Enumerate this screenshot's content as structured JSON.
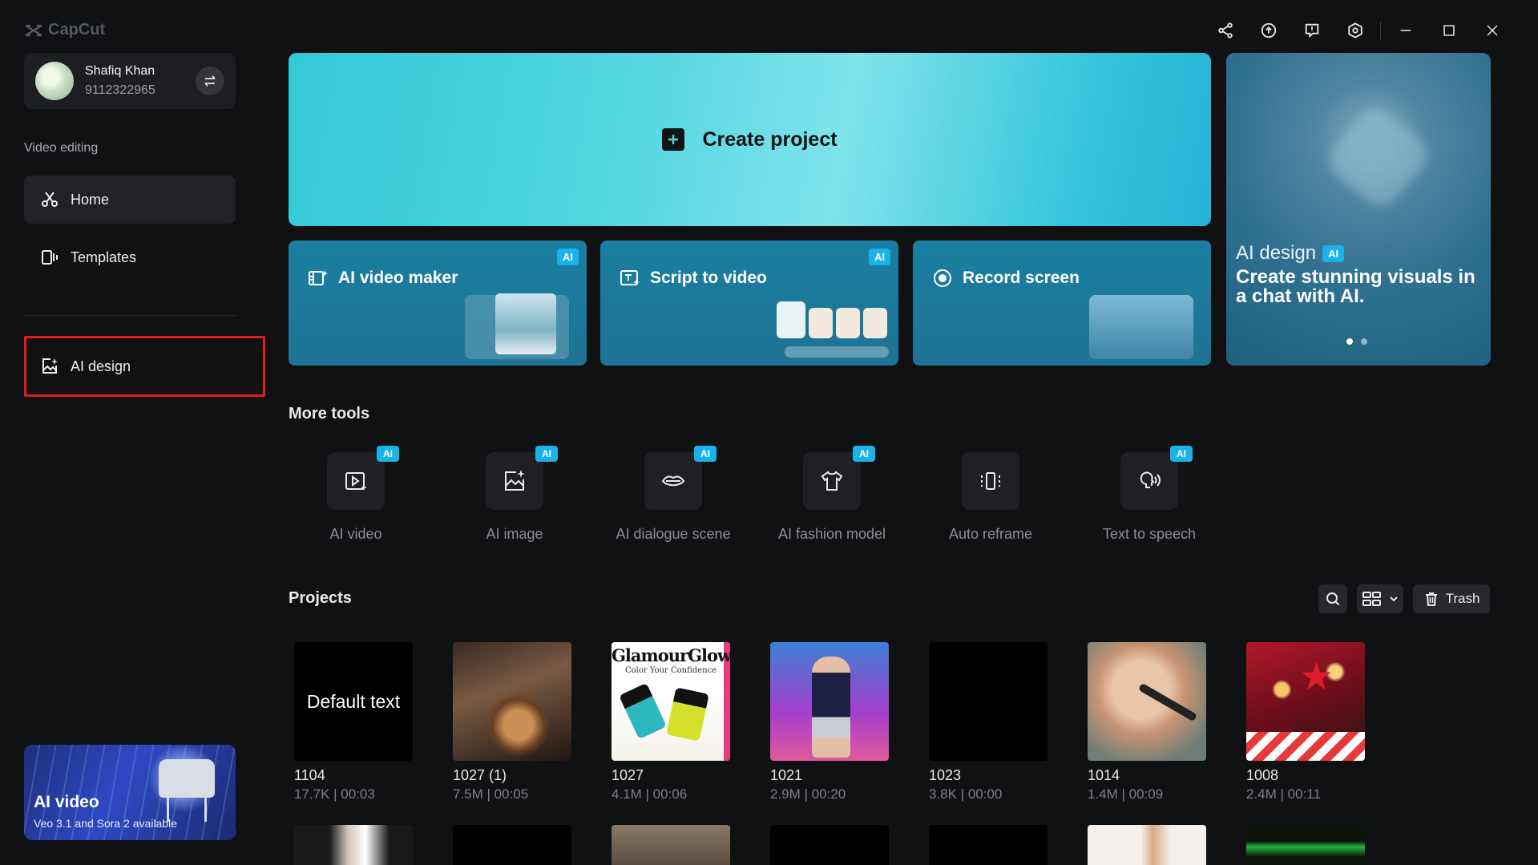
{
  "app": {
    "name": "CapCut"
  },
  "profile": {
    "name": "Shafiq Khan",
    "number": "9112322965"
  },
  "sidebar": {
    "section": "Video editing",
    "items": [
      {
        "label": "Home",
        "icon": "scissors-icon",
        "active": true
      },
      {
        "label": "Templates",
        "icon": "template-icon"
      },
      {
        "label": "AI design",
        "icon": "image-sparkle-icon",
        "highlighted": true
      }
    ],
    "promo": {
      "title": "AI video",
      "subtitle": "Veo 3.1 and Sora 2 available"
    }
  },
  "hero": {
    "create_label": "Create project",
    "tiles": [
      {
        "label": "AI video maker",
        "badge": "AI"
      },
      {
        "label": "Script to video",
        "badge": "AI"
      },
      {
        "label": "Record screen"
      }
    ],
    "ai_design": {
      "label": "AI design",
      "badge": "AI",
      "title": "Create stunning visuals in a chat with AI."
    }
  },
  "more_tools": {
    "heading": "More tools",
    "items": [
      {
        "label": "AI video",
        "badge": "AI"
      },
      {
        "label": "AI image",
        "badge": "AI"
      },
      {
        "label": "AI dialogue scene",
        "badge": "AI"
      },
      {
        "label": "AI fashion model",
        "badge": "AI"
      },
      {
        "label": "Auto reframe"
      },
      {
        "label": "Text to speech",
        "badge": "AI"
      }
    ]
  },
  "projects": {
    "heading": "Projects",
    "trash_label": "Trash",
    "items": [
      {
        "name": "1104",
        "meta": "17.7K | 00:03",
        "thumb_text": "Default text"
      },
      {
        "name": "1027 (1)",
        "meta": "7.5M | 00:05"
      },
      {
        "name": "1027",
        "meta": "4.1M | 00:06",
        "thumb_title": "GlamourGlow",
        "thumb_sub": "Color Your Confidence"
      },
      {
        "name": "1021",
        "meta": "2.9M | 00:20"
      },
      {
        "name": "1023",
        "meta": "3.8K | 00:00"
      },
      {
        "name": "1014",
        "meta": "1.4M | 00:09"
      },
      {
        "name": "1008",
        "meta": "2.4M | 00:11"
      }
    ]
  },
  "colors": {
    "background": "#101113",
    "accent_ai_badge": "#19b3ea",
    "highlight_border": "#e41c1c",
    "create_gradient_start": "#34c9d6",
    "tile_bg": "#1a7fa0"
  }
}
